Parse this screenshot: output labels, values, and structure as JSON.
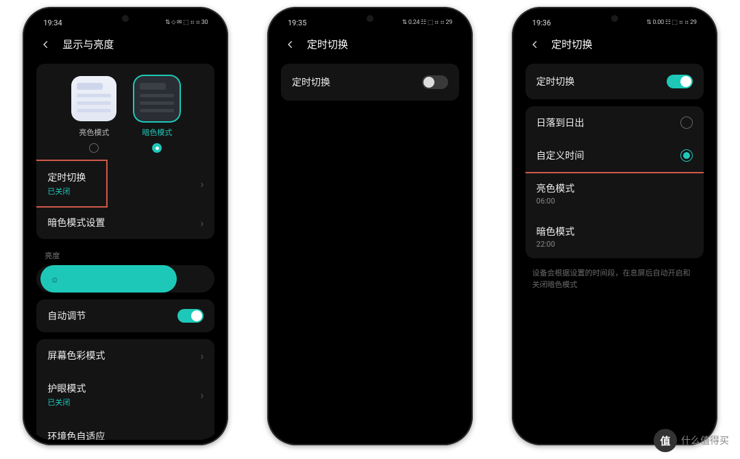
{
  "colors": {
    "accent": "#1ec8b9",
    "highlight": "#d05a4a"
  },
  "watermark": {
    "badge": "值",
    "text": "什么值得买"
  },
  "phone1": {
    "status": {
      "time": "19:34",
      "right": "⇅ ⬦ ✉ ⬚ ⠶ ⠶ 30"
    },
    "title": "显示与亮度",
    "theme": {
      "light_label": "亮色模式",
      "dark_label": "暗色模式",
      "selected": "dark"
    },
    "scheduled": {
      "label": "定时切换",
      "sub": "已关闭"
    },
    "dark_settings": {
      "label": "暗色模式设置"
    },
    "brightness_label": "亮度",
    "auto_adjust": {
      "label": "自动调节",
      "on": true
    },
    "color_mode": {
      "label": "屏幕色彩模式"
    },
    "eye": {
      "label": "护眼模式",
      "sub": "已关闭"
    },
    "ambient": {
      "label": "环境色自适应"
    }
  },
  "phone2": {
    "status": {
      "time": "19:35",
      "right": "⇅ 0.24 ☷ ⬚ ⠶ ⠶ 29"
    },
    "title": "定时切换",
    "toggle": {
      "label": "定时切换",
      "on": false
    }
  },
  "phone3": {
    "status": {
      "time": "19:36",
      "right": "⇅ 0.00 ☷ ⬚ ⠶ ⠶ 29"
    },
    "title": "定时切换",
    "toggle": {
      "label": "定时切换",
      "on": true
    },
    "opt_sunset": {
      "label": "日落到日出",
      "selected": false
    },
    "opt_custom": {
      "label": "自定义时间",
      "selected": true
    },
    "light": {
      "label": "亮色模式",
      "time": "06:00"
    },
    "dark": {
      "label": "暗色模式",
      "time": "22:00"
    },
    "note": "设备会根据设置的时间段，在息屏后自动开启和关闭暗色模式"
  }
}
